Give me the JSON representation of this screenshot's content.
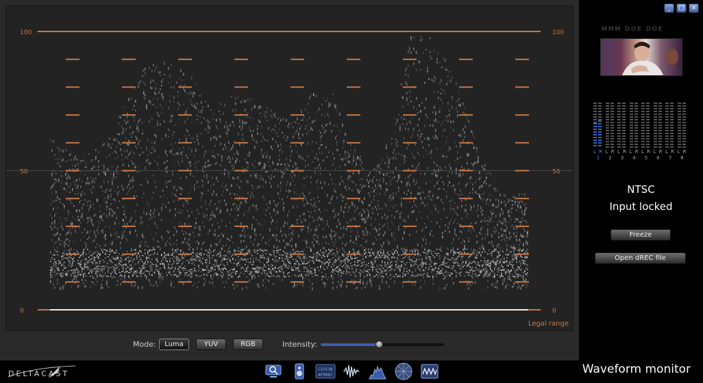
{
  "scope": {
    "scale_labels": [
      "100",
      "50",
      "0"
    ],
    "legal_range_label": "Legal range",
    "colors": {
      "graticule": "#c8794a",
      "trace": "#e8e8e8",
      "background": "#232323"
    }
  },
  "controls": {
    "mode_label": "Mode:",
    "modes": [
      "Luma",
      "YUV",
      "RGB"
    ],
    "active_mode": "Luma",
    "intensity_label": "Intensity:",
    "intensity_value": 0.47
  },
  "side": {
    "window_buttons": [
      "_",
      "□",
      "×"
    ],
    "thumbnail_caption": "MMM DOE DOE",
    "audio": {
      "channels": [
        {
          "num": "1",
          "lr": "L R",
          "level": [
            0.55,
            0.6
          ],
          "selected": true
        },
        {
          "num": "2",
          "lr": "L R",
          "level": [
            0,
            0
          ]
        },
        {
          "num": "3",
          "lr": "L R",
          "level": [
            0,
            0
          ]
        },
        {
          "num": "4",
          "lr": "L R",
          "level": [
            0,
            0
          ]
        },
        {
          "num": "5",
          "lr": "L R",
          "level": [
            0,
            0
          ]
        },
        {
          "num": "6",
          "lr": "L R",
          "level": [
            0,
            0
          ]
        },
        {
          "num": "7",
          "lr": "L R",
          "level": [
            0,
            0
          ]
        },
        {
          "num": "8",
          "lr": "L R",
          "level": [
            0,
            0
          ]
        }
      ]
    },
    "video_standard": "NTSC",
    "input_status": "Input locked",
    "freeze_label": "Freeze",
    "open_file_label": "Open dREC file"
  },
  "bottom": {
    "logo_text": "DELTACAST",
    "tools": [
      "monitor-icon",
      "speaker-icon",
      "hex-data-icon",
      "audio-wave-icon",
      "histogram-icon",
      "vectorscope-icon",
      "waveform-icon"
    ],
    "page_title": "Waveform monitor"
  }
}
